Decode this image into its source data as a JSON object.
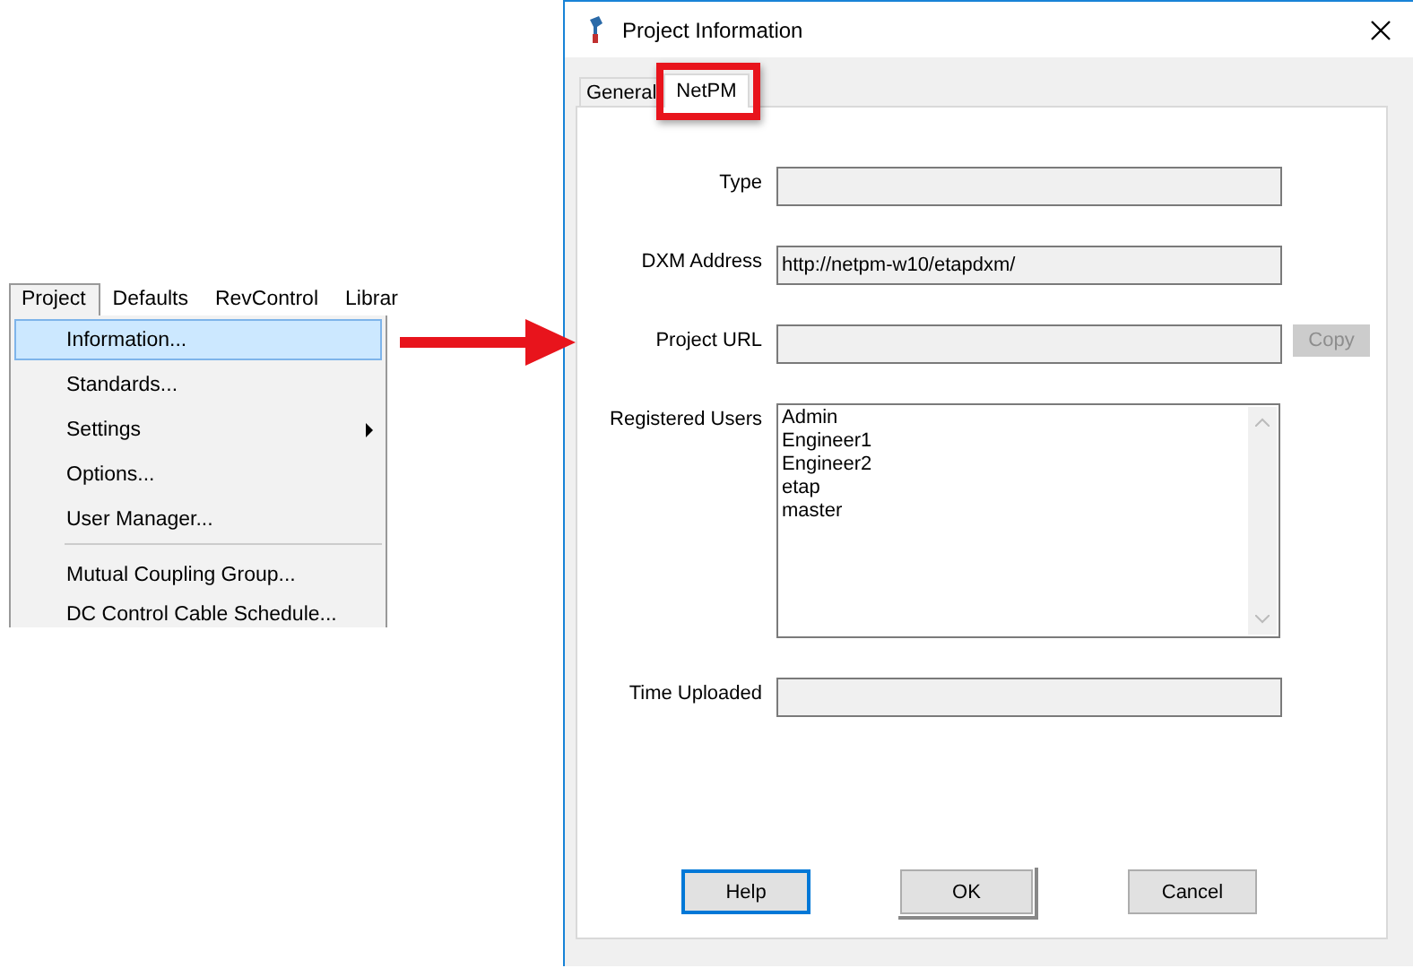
{
  "menu_bar": [
    {
      "label": "Project",
      "selected": true
    },
    {
      "label": "Defaults",
      "selected": false
    },
    {
      "label": "RevControl",
      "selected": false
    },
    {
      "label": "Librar",
      "selected": false
    }
  ],
  "menu": [
    {
      "kind": "item",
      "label": "Information...",
      "selected": true,
      "submenu": false
    },
    {
      "kind": "item",
      "label": "Standards...",
      "selected": false,
      "submenu": false
    },
    {
      "kind": "item",
      "label": "Settings",
      "selected": false,
      "submenu": true
    },
    {
      "kind": "item",
      "label": "Options...",
      "selected": false,
      "submenu": false
    },
    {
      "kind": "item",
      "label": "User Manager...",
      "selected": false,
      "submenu": false
    },
    {
      "kind": "separator"
    },
    {
      "kind": "item",
      "label": "Mutual Coupling Group...",
      "selected": false,
      "submenu": false
    },
    {
      "kind": "item",
      "label": "DC Control Cable Schedule...",
      "selected": false,
      "submenu": false
    }
  ],
  "dialog": {
    "title": "Project Information",
    "tabs": [
      {
        "label": "General",
        "selected": false
      },
      {
        "label": "NetPM",
        "selected": true,
        "highlighted": true
      }
    ],
    "fields": [
      {
        "kind": "text",
        "label": "Type"
      },
      {
        "kind": "text",
        "label": "DXM Address",
        "value": "http://netpm-w10/etapdxm/"
      },
      {
        "kind": "text",
        "label": "Project URL",
        "button": {
          "label": "Copy",
          "disabled": true
        }
      },
      {
        "kind": "list",
        "label": "Registered Users",
        "items": [
          "Admin",
          "Engineer1",
          "Engineer2",
          "etap",
          "master"
        ]
      },
      {
        "kind": "text",
        "label": "Time Uploaded"
      }
    ],
    "buttons": [
      {
        "label": "Help",
        "focused": true,
        "default": false
      },
      {
        "label": "OK",
        "focused": false,
        "default": true
      },
      {
        "label": "Cancel",
        "focused": false,
        "default": false
      }
    ]
  }
}
